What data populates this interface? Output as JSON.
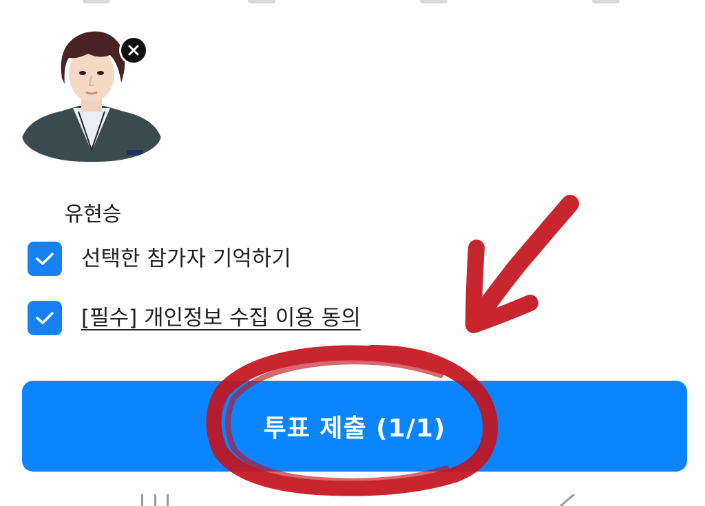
{
  "candidate": {
    "name": "유현승",
    "photo_icon": "person-photo",
    "remove_icon": "close-icon"
  },
  "options": [
    {
      "label": "선택한 참가자 기억하기",
      "checked": true,
      "underline": false
    },
    {
      "label": "[필수] 개인정보 수집 이용 동의",
      "checked": true,
      "underline": true
    }
  ],
  "submit": {
    "label": "투표 제출 (1/1)"
  },
  "nav": {
    "recents_icon": "recents-icon",
    "back_icon": "back-icon"
  },
  "colors": {
    "accent": "#0a84ff",
    "checkbox": "#1682f2",
    "annotation": "#c3141e"
  }
}
